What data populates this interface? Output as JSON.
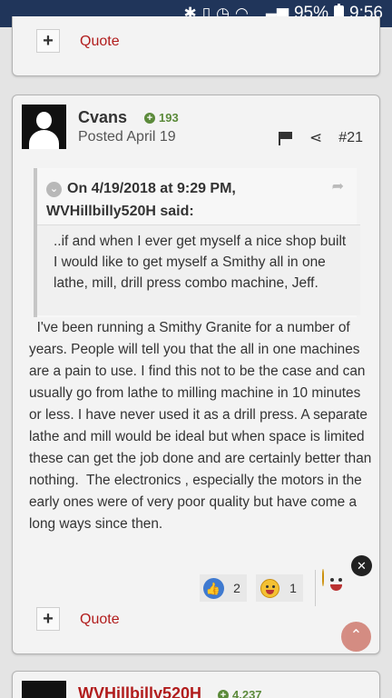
{
  "status_bar": {
    "battery": "95%",
    "time": "9:56"
  },
  "prev_post": {
    "quote_label": "Quote"
  },
  "post": {
    "author": "Cvans",
    "reputation": "193",
    "posted": "Posted April 19",
    "number": "#21",
    "quote": {
      "header_line1": "On 4/19/2018 at 9:29 PM,",
      "header_line2": "WVHillbilly520H said:",
      "body": "..if and when I ever get myself a nice shop built I would like to get myself a Smithy all in one lathe, mill, drill press combo machine, Jeff."
    },
    "content": "  I've been running a Smithy Granite for a number of years. People will tell you that the all in one machines are a pain to use. I find this not to be the case and can usually go from lathe to milling machine in 10 minutes or less. I have never used it as a drill press. A separate lathe and mill would be ideal but when space is limited these can get the job done and are certainly better than nothing.  The electronics , especially the motors in the early ones were of very poor quality but have come a long ways since then.",
    "reactions": [
      {
        "icon": "thumbs-up-icon",
        "count": "2"
      },
      {
        "icon": "laughing-smiley-icon",
        "count": "1"
      }
    ],
    "quote_label": "Quote"
  },
  "next_post": {
    "author": "WVHillbilly520H",
    "reputation": "4,237"
  },
  "colors": {
    "status_bar": "#20355a",
    "link_red": "#b11c1c",
    "rep_green": "#5b8a3a",
    "like_blue": "#3f7ad0",
    "scroll_top_button": "#d3877d"
  }
}
